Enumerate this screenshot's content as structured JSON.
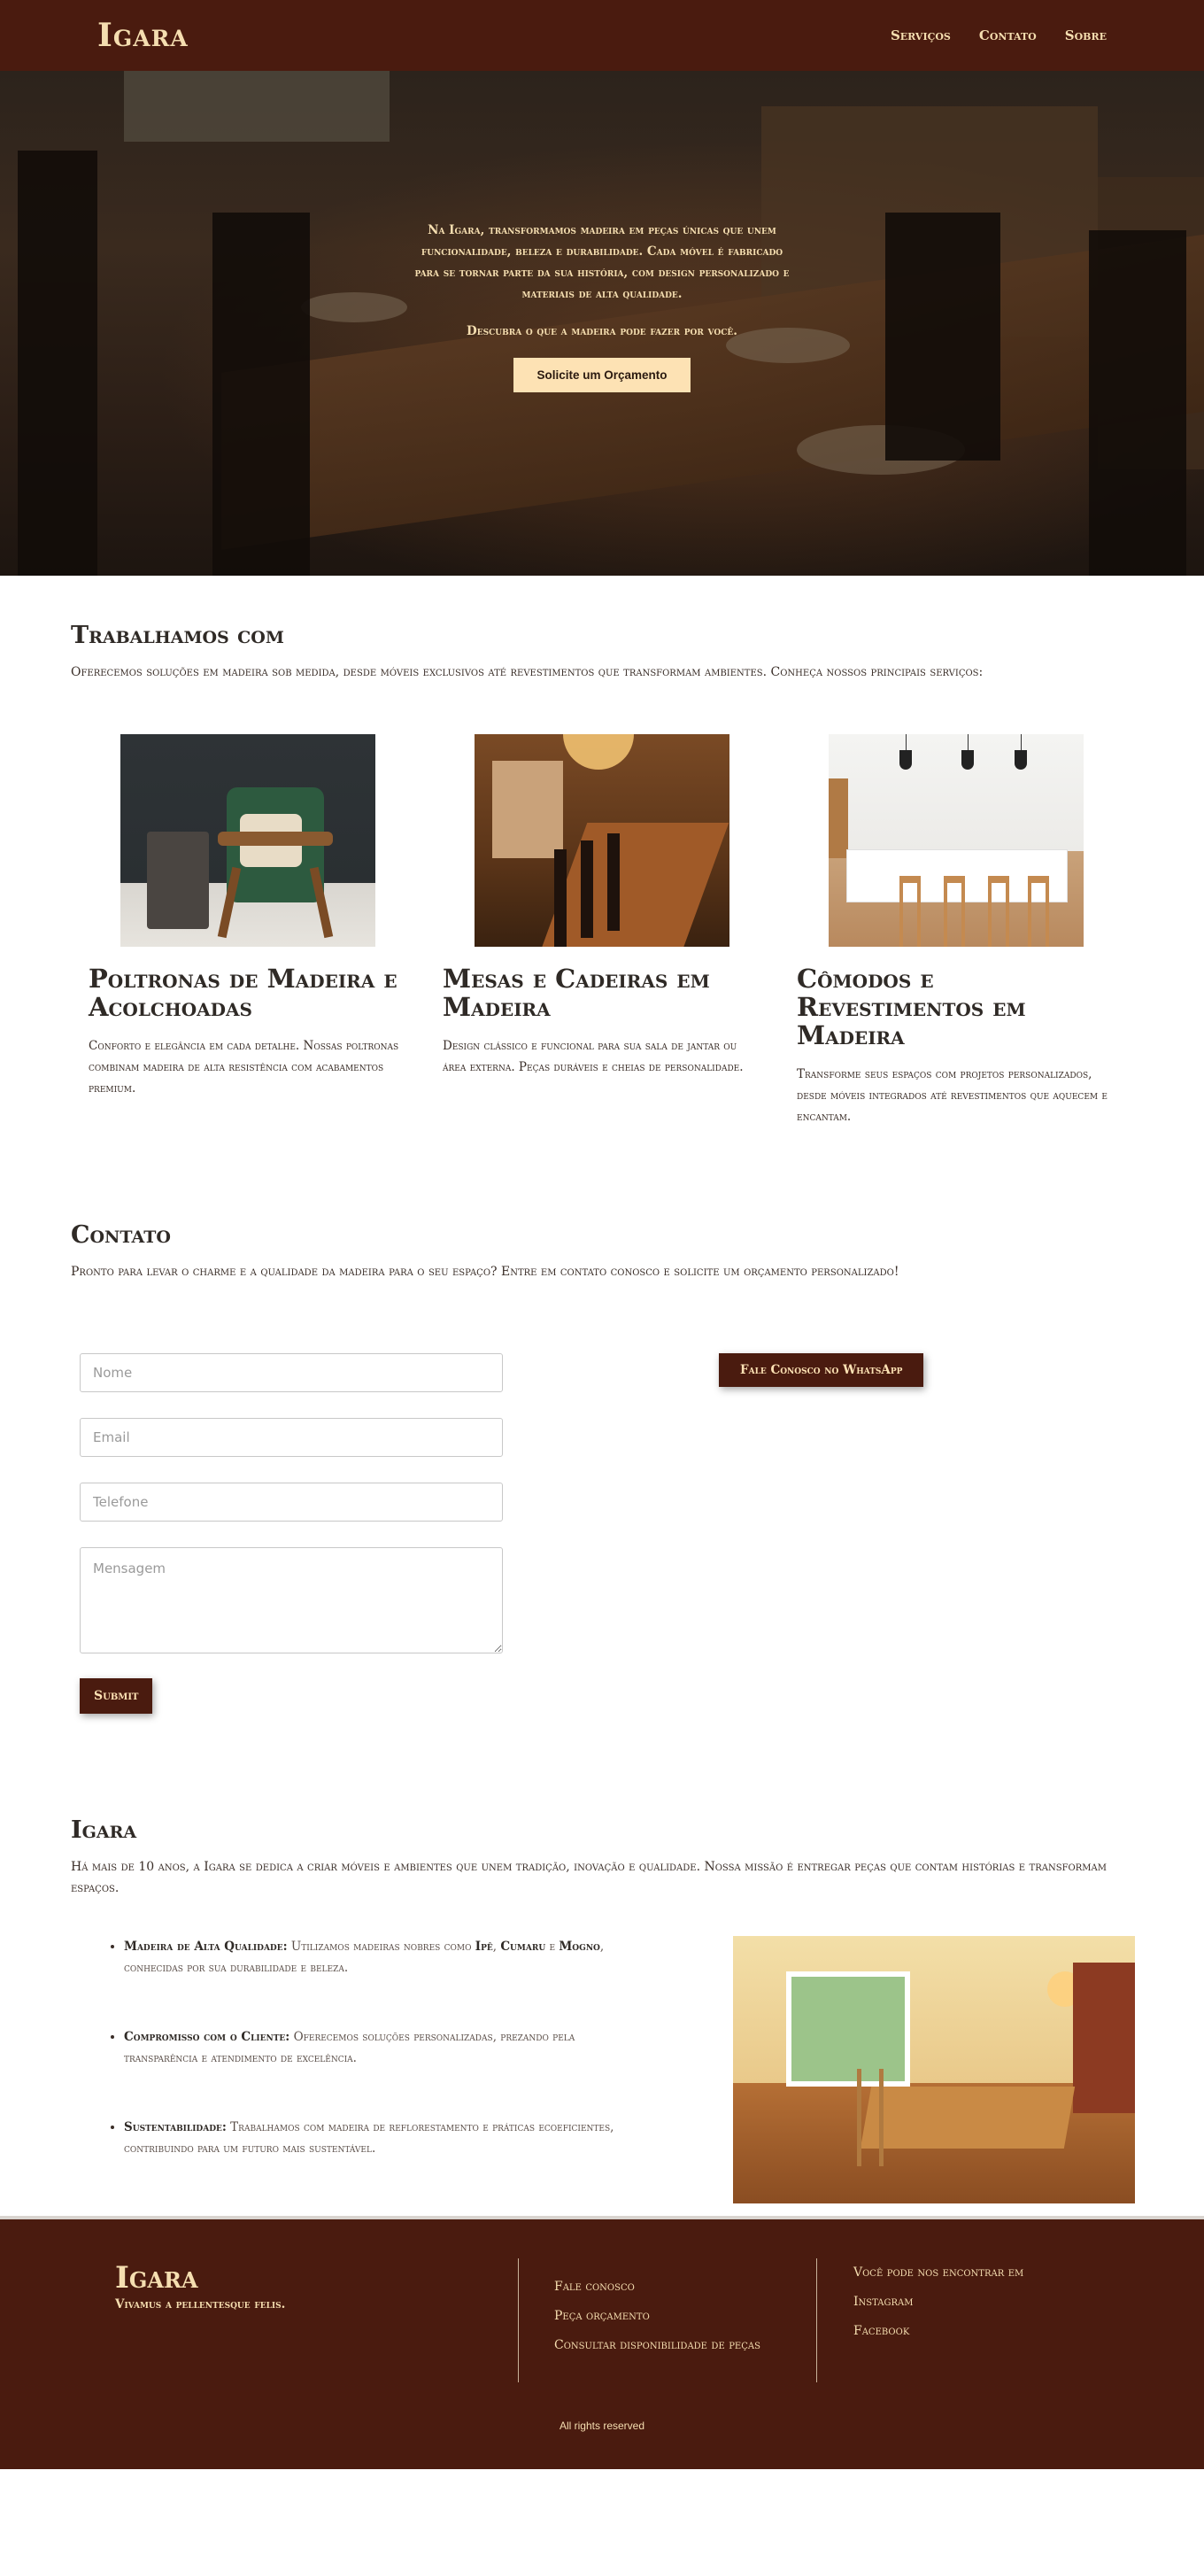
{
  "header": {
    "logo": "Igara",
    "nav": [
      "Serviços",
      "Contato",
      "Sobre"
    ]
  },
  "hero": {
    "text": "Na Igara, transformamos madeira em peças únicas que unem funcionalidade, beleza e durabilidade. Cada móvel é fabricado para se tornar parte da sua história, com design personalizado e materiais de alta qualidade.",
    "sub": "Descubra o que a madeira pode fazer por você.",
    "button": "Solicite um Orçamento"
  },
  "services": {
    "title": "Trabalhamos com",
    "lead": "Oferecemos soluções em madeira sob medida, desde móveis exclusivos até revestimentos que transformam ambientes. Conheça nossos principais serviços:",
    "cards": [
      {
        "title": "Poltronas de Madeira e Acolchoadas",
        "text": "Conforto e elegância em cada detalhe. Nossas poltronas combinam madeira de alta resistência com acabamentos premium."
      },
      {
        "title": "Mesas e Cadeiras em Madeira",
        "text": "Design clássico e funcional para sua sala de jantar ou área externa. Peças duráveis e cheias de personalidade."
      },
      {
        "title": "Cômodos e Revestimentos em Madeira",
        "text": "Transforme seus espaços com projetos personalizados, desde móveis integrados até revestimentos que aquecem e encantam."
      }
    ]
  },
  "contact": {
    "title": "Contato",
    "lead": "Pronto para levar o charme e a qualidade da madeira para o seu espaço? Entre em contato conosco e solicite um orçamento personalizado!",
    "placeholders": {
      "name": "Nome",
      "email": "Email",
      "phone": "Telefone",
      "message": "Mensagem"
    },
    "submit": "Submit",
    "whatsapp": "Fale Conosco no WhatsApp"
  },
  "about": {
    "title": "Igara",
    "lead": "Há mais de 10 anos, a Igara se dedica a criar móveis e ambientes que unem tradição, inovação e qualidade. Nossa missão é entregar peças que contam histórias e transformam espaços.",
    "items": [
      {
        "label": "Madeira de Alta Qualidade:",
        "pre": "Utilizamos madeiras nobres como ",
        "b1": "Ipê",
        "sep1": ", ",
        "b2": "Cumaru",
        "sep2": " e ",
        "b3": "Mogno",
        "post": ", conhecidas por sua durabilidade e beleza."
      },
      {
        "label": "Compromisso com o Cliente:",
        "text": "Oferecemos soluções personalizadas, prezando pela transparência e atendimento de excelência."
      },
      {
        "label": "Sustentabilidade:",
        "text": "Trabalhamos com madeira de reflorestamento e práticas ecoeficientes, contribuindo para um futuro mais sustentável."
      }
    ]
  },
  "footer": {
    "brand": "Igara",
    "tagline": "Vivamus a pellentesque felis.",
    "links": [
      "Fale conosco",
      "Peça orçamento",
      "Consultar disponibilidade de peças"
    ],
    "social_title": "Você pode nos encontrar em",
    "social": [
      "Instagram",
      "Facebook"
    ],
    "rights": "All rights reserved"
  }
}
